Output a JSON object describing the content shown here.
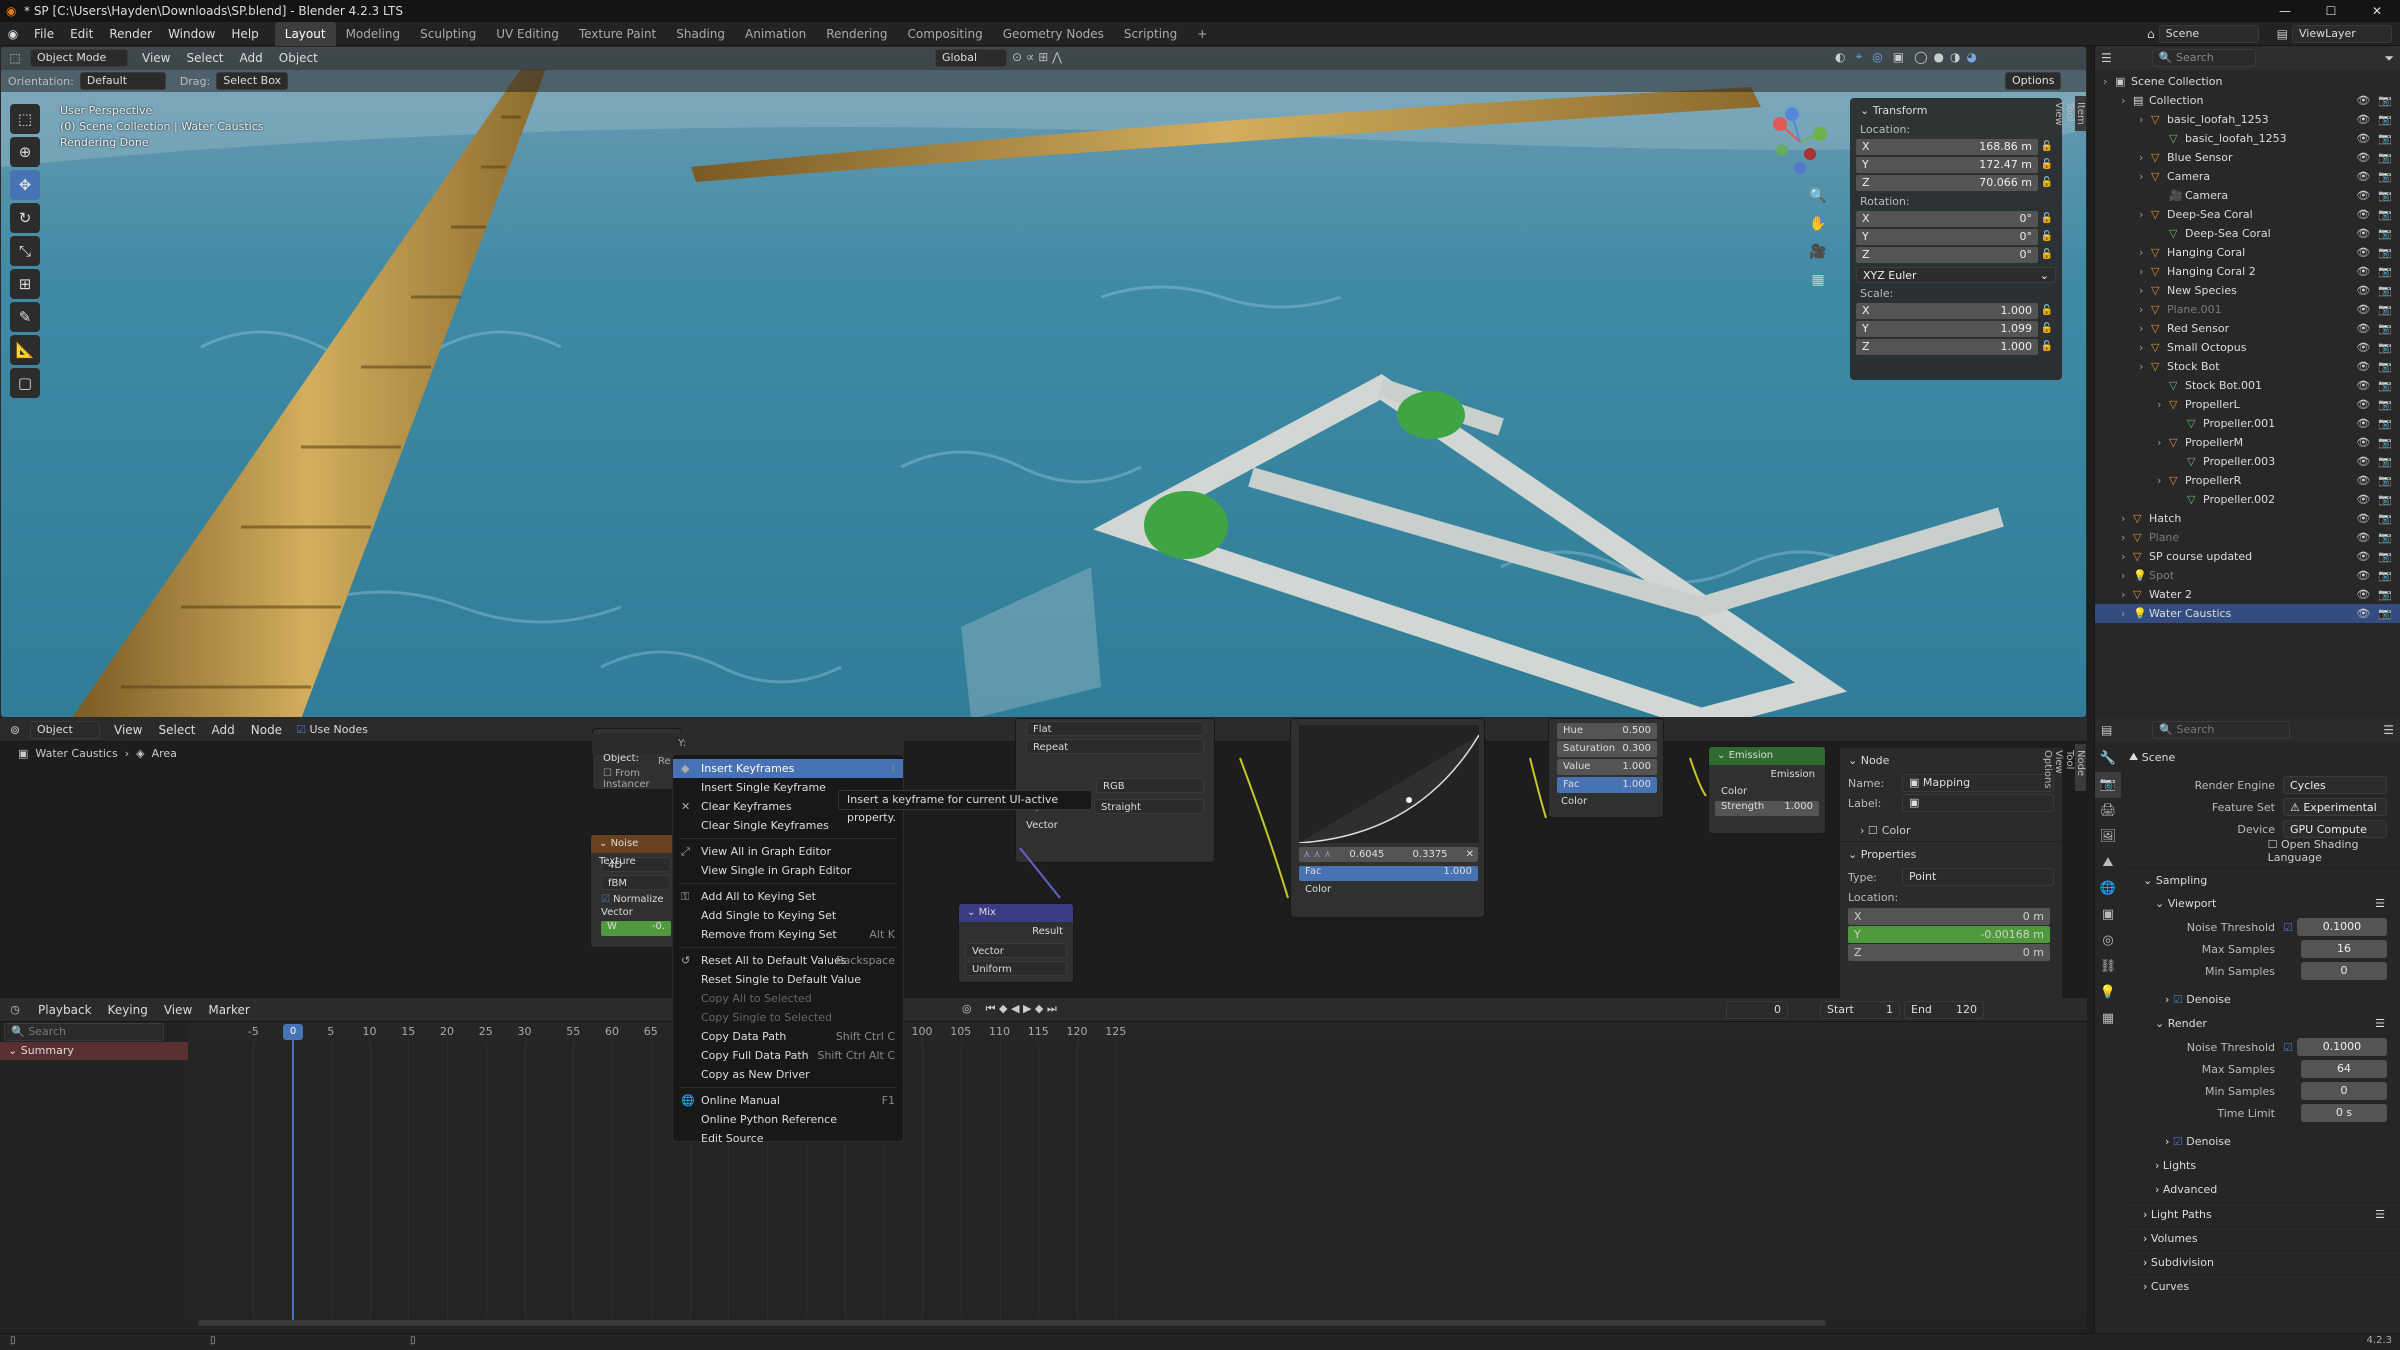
{
  "window": {
    "title": "* SP [C:\\Users\\Hayden\\Downloads\\SP.blend] - Blender 4.2.3 LTS",
    "controls": [
      "—",
      "☐",
      "✕"
    ]
  },
  "menu": [
    "File",
    "Edit",
    "Render",
    "Window",
    "Help"
  ],
  "workspaces": [
    "Layout",
    "Modeling",
    "Sculpting",
    "UV Editing",
    "Texture Paint",
    "Shading",
    "Animation",
    "Rendering",
    "Compositing",
    "Geometry Nodes",
    "Scripting",
    "+"
  ],
  "topright": {
    "scene": "Scene",
    "viewlayer": "ViewLayer"
  },
  "viewport": {
    "mode": "Object Mode",
    "menus": [
      "View",
      "Select",
      "Add",
      "Object"
    ],
    "transform_orient": "Global",
    "orientation_label": "Orientation:",
    "orientation_val": "Default",
    "drag_label": "Drag:",
    "drag_val": "Select Box",
    "options": "Options",
    "overlay_lines": [
      "User Perspective",
      "(0) Scene Collection | Water Caustics",
      "Rendering Done"
    ],
    "side_tabs": [
      "Item",
      "Tool",
      "View"
    ]
  },
  "npanel": {
    "title": "Transform",
    "location_label": "Location:",
    "location": [
      {
        "a": "X",
        "v": "168.86 m"
      },
      {
        "a": "Y",
        "v": "172.47 m"
      },
      {
        "a": "Z",
        "v": "70.066 m"
      }
    ],
    "rotation_label": "Rotation:",
    "rotation": [
      {
        "a": "X",
        "v": "0°"
      },
      {
        "a": "Y",
        "v": "0°"
      },
      {
        "a": "Z",
        "v": "0°"
      }
    ],
    "rotation_mode": "XYZ Euler",
    "scale_label": "Scale:",
    "scale": [
      {
        "a": "X",
        "v": "1.000"
      },
      {
        "a": "Y",
        "v": "1.099"
      },
      {
        "a": "Z",
        "v": "1.000"
      }
    ]
  },
  "outliner": {
    "search": "Search",
    "items": [
      {
        "label": "Scene Collection",
        "indent": 0,
        "type": "scene"
      },
      {
        "label": "Collection",
        "indent": 1,
        "type": "collection"
      },
      {
        "label": "basic_loofah_1253",
        "indent": 2,
        "type": "object"
      },
      {
        "label": "basic_loofah_1253",
        "indent": 3,
        "type": "mesh"
      },
      {
        "label": "Blue Sensor",
        "indent": 2,
        "type": "object"
      },
      {
        "label": "Camera",
        "indent": 2,
        "type": "object"
      },
      {
        "label": "Camera",
        "indent": 3,
        "type": "camera"
      },
      {
        "label": "Deep-Sea Coral",
        "indent": 2,
        "type": "object"
      },
      {
        "label": "Deep-Sea Coral",
        "indent": 3,
        "type": "mesh"
      },
      {
        "label": "Hanging Coral",
        "indent": 2,
        "type": "object"
      },
      {
        "label": "Hanging Coral 2",
        "indent": 2,
        "type": "object"
      },
      {
        "label": "New Species",
        "indent": 2,
        "type": "object"
      },
      {
        "label": "Plane.001",
        "indent": 2,
        "type": "object",
        "dim": true
      },
      {
        "label": "Red Sensor",
        "indent": 2,
        "type": "object"
      },
      {
        "label": "Small Octopus",
        "indent": 2,
        "type": "object"
      },
      {
        "label": "Stock Bot",
        "indent": 2,
        "type": "object"
      },
      {
        "label": "Stock Bot.001",
        "indent": 3,
        "type": "mesh"
      },
      {
        "label": "PropellerL",
        "indent": 3,
        "type": "object"
      },
      {
        "label": "Propeller.001",
        "indent": 4,
        "type": "mesh"
      },
      {
        "label": "PropellerM",
        "indent": 3,
        "type": "object"
      },
      {
        "label": "Propeller.003",
        "indent": 4,
        "type": "mesh"
      },
      {
        "label": "PropellerR",
        "indent": 3,
        "type": "object"
      },
      {
        "label": "Propeller.002",
        "indent": 4,
        "type": "mesh"
      },
      {
        "label": "Hatch",
        "indent": 1,
        "type": "object"
      },
      {
        "label": "Plane",
        "indent": 1,
        "type": "object",
        "dim": true
      },
      {
        "label": "SP course updated",
        "indent": 1,
        "type": "object"
      },
      {
        "label": "Spot",
        "indent": 1,
        "type": "light",
        "dim": true
      },
      {
        "label": "Water 2",
        "indent": 1,
        "type": "object"
      },
      {
        "label": "Water Caustics",
        "indent": 1,
        "type": "light",
        "selected": true
      }
    ]
  },
  "node_editor": {
    "type": "Object",
    "menus": [
      "View",
      "Select",
      "Add",
      "Node"
    ],
    "use_nodes": "Use Nodes",
    "breadcrumb": [
      "Water Caustics",
      "Area"
    ],
    "side_tabs": [
      "Node",
      "Tool",
      "View",
      "Options"
    ],
    "n_node": {
      "title": "Node",
      "name_label": "Name:",
      "name": "Mapping",
      "label_label": "Label:",
      "color": "Color",
      "properties": "Properties",
      "type_label": "Type:",
      "type": "Point",
      "location_label": "Location:",
      "location": [
        {
          "a": "X",
          "v": "0 m"
        },
        {
          "a": "Y",
          "v": "-0.00168 m"
        },
        {
          "a": "Z",
          "v": "0 m"
        }
      ]
    },
    "nodes": {
      "noise_title": "Noise Texture",
      "noise_dim": "4D",
      "noise_type": "fBM",
      "normalize": "Normalize",
      "vector": "Vector",
      "w": "W",
      "w_val": "-0.",
      "object_label": "Object:",
      "from_instancer": "From Instancer",
      "image_opts": [
        "Flat",
        "Repeat",
        "RGB"
      ],
      "alpha": "Alpha",
      "alpha_val": "Straight",
      "vector_out": "Vector",
      "mix": "Mix",
      "result": "Result",
      "mix_a": "Vector",
      "mix_b": "Uniform",
      "curve_vals": [
        "0.6045",
        "0.3375"
      ],
      "fac": "Fac",
      "fac_val": "1.000",
      "color": "Color",
      "hsv": [
        {
          "k": "Hue",
          "v": "0.500"
        },
        {
          "k": "Saturation",
          "v": "0.300"
        },
        {
          "k": "Value",
          "v": "1.000"
        },
        {
          "k": "Fac",
          "v": "1.000"
        }
      ],
      "hsv_color": "Color",
      "emission": "Emission",
      "em_out": "Emission",
      "em_color": "Color",
      "strength": "Strength",
      "strength_val": "1.000"
    }
  },
  "context_menu": {
    "heading": "Y:",
    "stub": "Re",
    "items": [
      {
        "label": "Insert Keyframes",
        "shortcut": "I",
        "highlight": true,
        "icon": "◆"
      },
      {
        "label": "Insert Single Keyframe",
        "shortcut": ""
      },
      {
        "label": "Clear Keyframes",
        "shortcut": "",
        "icon": "✕"
      },
      {
        "label": "Clear Single Keyframes",
        "shortcut": ""
      },
      {
        "sep": true
      },
      {
        "label": "View All in Graph Editor",
        "shortcut": "",
        "icon": "⤢"
      },
      {
        "label": "View Single in Graph Editor",
        "shortcut": ""
      },
      {
        "sep": true
      },
      {
        "label": "Add All to Keying Set",
        "shortcut": "",
        "icon": "⚿"
      },
      {
        "label": "Add Single to Keying Set",
        "shortcut": ""
      },
      {
        "label": "Remove from Keying Set",
        "shortcut": "Alt K"
      },
      {
        "sep": true
      },
      {
        "label": "Reset All to Default Values",
        "shortcut": "Backspace",
        "icon": "↺"
      },
      {
        "label": "Reset Single to Default Value",
        "shortcut": ""
      },
      {
        "label": "Copy All to Selected",
        "shortcut": "",
        "disabled": true
      },
      {
        "label": "Copy Single to Selected",
        "shortcut": "",
        "disabled": true
      },
      {
        "label": "Copy Data Path",
        "shortcut": "Shift Ctrl C"
      },
      {
        "label": "Copy Full Data Path",
        "shortcut": "Shift Ctrl Alt C"
      },
      {
        "label": "Copy as New Driver",
        "shortcut": ""
      },
      {
        "sep": true
      },
      {
        "label": "Online Manual",
        "shortcut": "F1",
        "icon": "🌐"
      },
      {
        "label": "Online Python Reference",
        "shortcut": ""
      },
      {
        "label": "Edit Source",
        "shortcut": ""
      }
    ]
  },
  "tooltip": "Insert a keyframe for current UI-active property.",
  "timeline": {
    "menus": [
      "Playback",
      "Keying",
      "View",
      "Marker"
    ],
    "search": "Search",
    "summary": "Summary",
    "ticks": [
      "-5",
      "0",
      "5",
      "10",
      "15",
      "20",
      "25",
      "30",
      "55",
      "60",
      "65",
      "70",
      "75",
      "80",
      "85",
      "90",
      "95",
      "100",
      "105",
      "110",
      "115",
      "120",
      "125"
    ],
    "current": "0",
    "start_label": "Start",
    "start": "1",
    "end_label": "End",
    "end": "120"
  },
  "properties": {
    "search": "Search",
    "scene": "Scene",
    "render_engine_label": "Render Engine",
    "render_engine": "Cycles",
    "feature_set_label": "Feature Set",
    "feature_set": "Experimental",
    "device_label": "Device",
    "device": "GPU Compute",
    "osl": "Open Shading Language",
    "sampling": "Sampling",
    "viewport": "Viewport",
    "vp_noise_label": "Noise Threshold",
    "vp_noise": "0.1000",
    "vp_max_label": "Max Samples",
    "vp_max": "16",
    "vp_min_label": "Min Samples",
    "vp_min": "0",
    "denoise": "Denoise",
    "render": "Render",
    "r_noise_label": "Noise Threshold",
    "r_noise": "0.1000",
    "r_max_label": "Max Samples",
    "r_max": "64",
    "r_min_label": "Min Samples",
    "r_min": "0",
    "r_time_label": "Time Limit",
    "r_time": "0 s",
    "denoise2": "Denoise",
    "lights": "Lights",
    "advanced": "Advanced",
    "light_paths": "Light Paths",
    "volumes": "Volumes",
    "subdivision": "Subdivision",
    "curves": "Curves"
  },
  "status": {
    "version": "4.2.3"
  },
  "colors": {
    "accent": "#4772b3",
    "selected_row": "#334d80",
    "emission_hdr": "#2f6b2f",
    "green_field": "#4f9a3a"
  }
}
